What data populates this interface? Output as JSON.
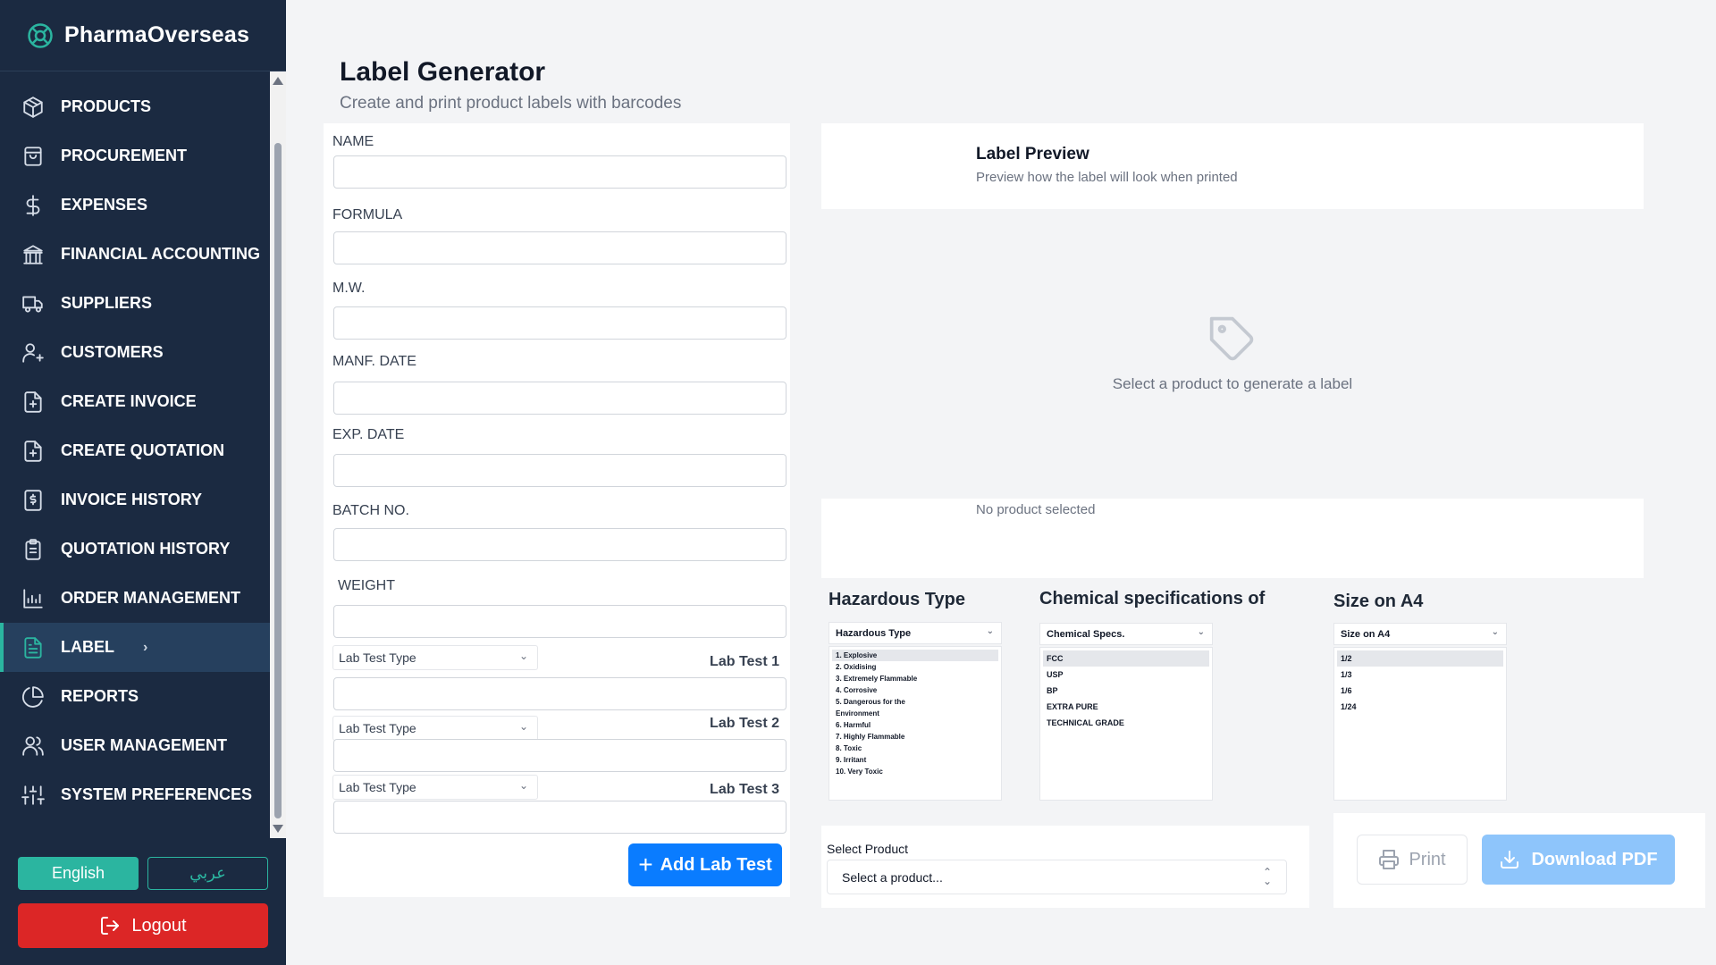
{
  "app": {
    "brand": "PharmaOverseas"
  },
  "sidebar": {
    "items": [
      {
        "label": "PRODUCTS",
        "icon": "package-icon"
      },
      {
        "label": "PROCUREMENT",
        "icon": "shopping-bag-icon"
      },
      {
        "label": "EXPENSES",
        "icon": "dollar-icon"
      },
      {
        "label": "FINANCIAL ACCOUNTING",
        "icon": "bank-icon"
      },
      {
        "label": "SUPPLIERS",
        "icon": "truck-icon"
      },
      {
        "label": "CUSTOMERS",
        "icon": "user-plus-icon"
      },
      {
        "label": "CREATE INVOICE",
        "icon": "file-plus-icon"
      },
      {
        "label": "CREATE QUOTATION",
        "icon": "file-plus-icon"
      },
      {
        "label": "INVOICE HISTORY",
        "icon": "receipt-icon"
      },
      {
        "label": "QUOTATION HISTORY",
        "icon": "clipboard-icon"
      },
      {
        "label": "ORDER MANAGEMENT",
        "icon": "chart-icon"
      },
      {
        "label": "LABEL",
        "icon": "file-text-icon",
        "active": true
      },
      {
        "label": "REPORTS",
        "icon": "pie-chart-icon"
      },
      {
        "label": "USER MANAGEMENT",
        "icon": "users-icon"
      },
      {
        "label": "SYSTEM PREFERENCES",
        "icon": "sliders-icon"
      }
    ],
    "lang_en": "English",
    "lang_ar": "عربي",
    "logout": "Logout",
    "accent": "#2bb5a0",
    "background": "#1b2a41"
  },
  "header": {
    "title": "Label Generator",
    "subtitle": "Create and print product labels with barcodes"
  },
  "form": {
    "name_label": "NAME",
    "formula_label": "FORMULA",
    "mw_label": "M.W.",
    "manf_label": "MANF. DATE",
    "exp_label": "EXP. DATE",
    "batch_label": "BATCH NO.",
    "weight_label": "WEIGHT",
    "lab_tests": [
      {
        "type_placeholder": "Lab Test Type",
        "name": "Lab Test 1"
      },
      {
        "type_placeholder": "Lab Test Type",
        "name": "Lab Test 2"
      },
      {
        "type_placeholder": "Lab Test Type",
        "name": "Lab Test 3"
      }
    ],
    "add_button": "Add Lab Test",
    "add_button_color": "#0a7cff"
  },
  "preview": {
    "title": "Label Preview",
    "subtitle": "Preview how the label will look when printed",
    "empty_text": "Select a product to generate a label",
    "footer_text": "No product selected"
  },
  "hazardous": {
    "title": "Hazardous Type",
    "select_value": "Hazardous Type",
    "options": [
      "1. Explosive",
      "2. Oxidising",
      "3. Extremely Flammable",
      "4. Corrosive",
      "5. Dangerous for the",
      "Environment",
      "6. Harmful",
      "7. Highly Flammable",
      "8. Toxic",
      "9. Irritant",
      "10. Very Toxic"
    ]
  },
  "chemical": {
    "title": "Chemical specifications of",
    "select_value": "Chemical Specs.",
    "options": [
      "FCC",
      "USP",
      "BP",
      "EXTRA PURE",
      "TECHNICAL GRADE"
    ]
  },
  "size": {
    "title": "Size on A4",
    "select_value": "Size on A4",
    "options": [
      "1/2",
      "1/3",
      "1/6",
      "1/24"
    ]
  },
  "select_product": {
    "label": "Select Product",
    "placeholder": "Select a product..."
  },
  "actions": {
    "print": "Print",
    "download": "Download PDF",
    "download_color": "#8ec5fb"
  }
}
